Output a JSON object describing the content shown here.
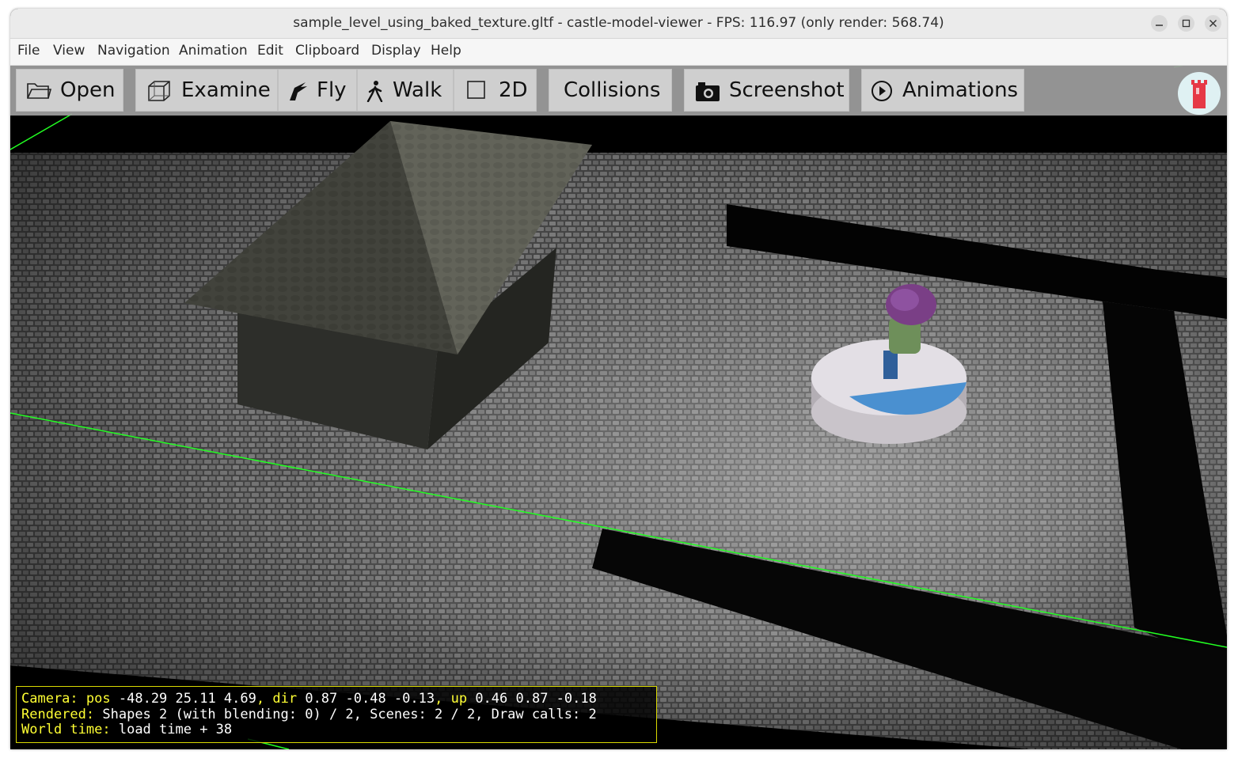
{
  "window": {
    "title": "sample_level_using_baked_texture.gltf - castle-model-viewer - FPS: 116.97 (only render: 568.74)",
    "controls": [
      "minimize-icon",
      "maximize-icon",
      "close-icon"
    ]
  },
  "menu": [
    "File",
    "View",
    "Navigation",
    "Animation",
    "Edit",
    "Clipboard",
    "Display",
    "Help"
  ],
  "toolbar": {
    "open": "Open",
    "examine": "Examine",
    "fly": "Fly",
    "walk": "Walk",
    "twod": "2D",
    "collisions": "Collisions",
    "screenshot": "Screenshot",
    "animations": "Animations",
    "icons": [
      "folder-icon",
      "cube-icon",
      "fly-icon",
      "walk-icon",
      "checkbox-icon",
      "camera-icon",
      "play-circle-icon",
      "castle-logo-icon"
    ]
  },
  "status": {
    "camera_label": "Camera:",
    "pos_label": "pos",
    "pos": "-48.29 25.11 4.69",
    "dir_label": "dir",
    "dir": "0.87 -0.48 -0.13",
    "up_label": "up",
    "up": "0.46 0.87 -0.18",
    "rendered_label": "Rendered:",
    "rendered": "Shapes 2 (with blending: 0) / 2, Scenes: 2 / 2, Draw calls: 2",
    "world_time_label": "World time:",
    "world_time": "load time + 38"
  },
  "colors": {
    "status_label": "#ffff33",
    "status_border": "#d9d900",
    "axis_line": "#22ff22",
    "platform_accent": "#4a90d0"
  }
}
